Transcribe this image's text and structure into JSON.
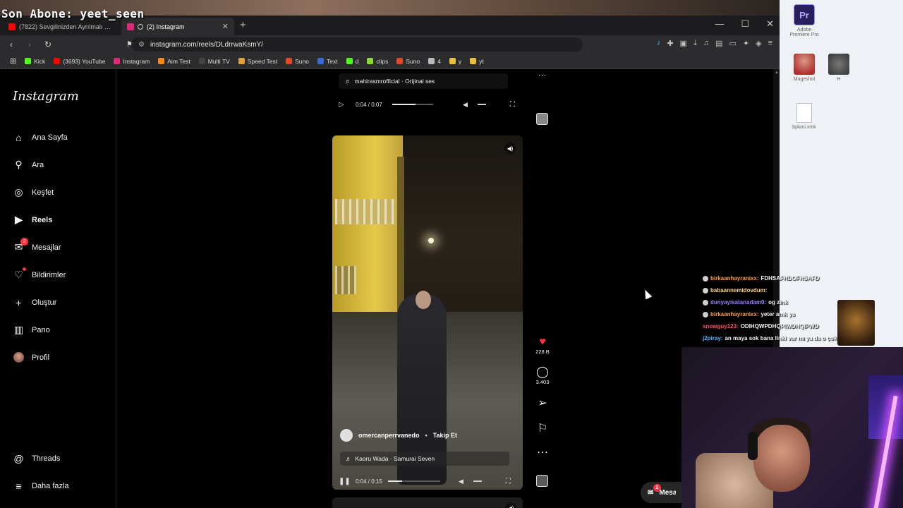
{
  "overlay": {
    "title": "Son Abone: yeet_seen"
  },
  "browser": {
    "tabs": [
      {
        "label": "(7822) Sevgilinizden Ayrılmalı mısınız",
        "color": "#ff0000"
      },
      {
        "label": "(2) Instagram",
        "color": "#dd2a7b"
      }
    ],
    "new_tab": "+",
    "url": "instagram.com/reels/DLdrrwaKsmY/",
    "bookmarks": [
      {
        "label": "Kick",
        "color": "#53fc18"
      },
      {
        "label": "(3693) YouTube",
        "color": "#ff0000"
      },
      {
        "label": "Instagram",
        "color": "#dd2a7b"
      },
      {
        "label": "Aim Test",
        "color": "#f6851b"
      },
      {
        "label": "Multi TV",
        "color": "#444444"
      },
      {
        "label": "Speed Test",
        "color": "#e0a040"
      },
      {
        "label": "Suno",
        "color": "#e04a2a"
      },
      {
        "label": "Text",
        "color": "#3a6ad8"
      },
      {
        "label": "d",
        "color": "#53fc18"
      },
      {
        "label": "clips",
        "color": "#8ad83a"
      },
      {
        "label": "Suno",
        "color": "#e04a2a"
      },
      {
        "label": "4",
        "color": "#bbbbbb"
      },
      {
        "label": "y",
        "color": "#e8c040"
      },
      {
        "label": "yt",
        "color": "#e8c040"
      }
    ]
  },
  "instagram": {
    "logo": "Instagram",
    "nav": [
      {
        "label": "Ana Sayfa",
        "icon": "home-icon",
        "glyph": "⌂"
      },
      {
        "label": "Ara",
        "icon": "search-icon",
        "glyph": "⚲"
      },
      {
        "label": "Keşfet",
        "icon": "explore-icon",
        "glyph": "◎"
      },
      {
        "label": "Reels",
        "icon": "reels-icon",
        "glyph": "▶"
      },
      {
        "label": "Mesajlar",
        "icon": "messenger-icon",
        "glyph": "✉",
        "badge": "2"
      },
      {
        "label": "Bildirimler",
        "icon": "heart-icon",
        "glyph": "♡"
      },
      {
        "label": "Oluştur",
        "icon": "plus-icon",
        "glyph": "+"
      },
      {
        "label": "Pano",
        "icon": "dashboard-icon",
        "glyph": "▥"
      },
      {
        "label": "Profil",
        "icon": "profile-avatar",
        "glyph": ""
      }
    ],
    "nav_bottom": [
      {
        "label": "Threads",
        "icon": "threads-icon",
        "glyph": "@"
      },
      {
        "label": "Daha fazla",
        "icon": "menu-icon",
        "glyph": "≡"
      }
    ],
    "top_reel": {
      "audio": "mahirasmrofficial · Orijinal ses",
      "time": "0:04 / 0:07",
      "progress": 0.57
    },
    "reel": {
      "author": "omercanperrvanedo",
      "follow": "Takip Et",
      "audio": "Kaoru Wada · Samurai Seven",
      "time": "0:04 / 0:15",
      "progress": 0.27,
      "likes": "228 B",
      "comments": "3.403"
    },
    "messages_pill": {
      "label": "Mesajlar",
      "badge": "2"
    }
  },
  "desktop": {
    "icons": [
      {
        "label": "Adobe Premiere Pro",
        "short": "Pr"
      },
      {
        "label": "Mugeshot"
      },
      {
        "label": "H"
      },
      {
        "label": "bplani.xmk"
      }
    ]
  },
  "chat": [
    {
      "user": "birkaanhayranixx:",
      "msg": "FDHSAFHDOFHSAFD",
      "color": "#ff9d3a"
    },
    {
      "user": "babaannemidovdum:",
      "msg": "",
      "color": "#ffd080"
    },
    {
      "user": "dunyayisatanadam0:",
      "msg": "og zink",
      "color": "#9a7dff"
    },
    {
      "user": "birkaanhayranixx:",
      "msg": "yeter amk ya",
      "color": "#ff9d3a"
    },
    {
      "user": "snowguy123:",
      "msg": "ODIHQWPDHQPIWDHQIPWD",
      "color": "#ff4d6d"
    },
    {
      "user": "j2piray:",
      "msg": "an maya sok bana linki var mı ya da o çok lazım",
      "color": "#5ab6ff"
    }
  ]
}
